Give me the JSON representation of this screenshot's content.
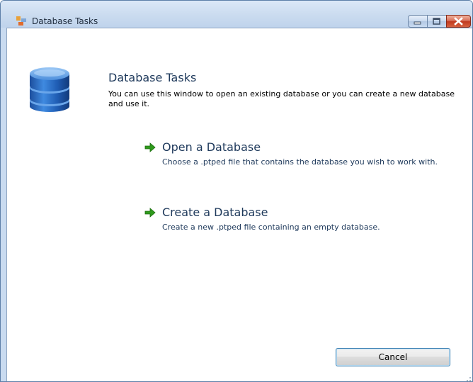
{
  "window": {
    "title": "Database Tasks",
    "icon": "database-window-icon",
    "controls": [
      "minimize-icon",
      "maximize-icon",
      "close-icon"
    ]
  },
  "main": {
    "icon": "database-icon",
    "heading": "Database Tasks",
    "intro": "You can use this window to open an existing database or you can create a new database and use it."
  },
  "tasks": [
    {
      "icon": "green-arrow-icon",
      "label": "Open a Database",
      "description": "Choose a .ptped file that contains the database you wish to work with."
    },
    {
      "icon": "green-arrow-icon",
      "label": "Create a Database",
      "description": "Create a new .ptped file containing an empty database."
    }
  ],
  "buttons": {
    "cancel_label": "Cancel"
  },
  "colors": {
    "accent_text": "#1e395b",
    "arrow_green": "#2f9a1c",
    "frame": "#c9dbf0"
  }
}
